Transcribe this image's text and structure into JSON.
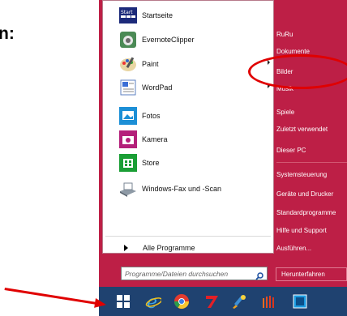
{
  "cut_label": "n:",
  "start_menu": {
    "programs": [
      {
        "label": "Startseite",
        "icon": "startseite-icon",
        "has_submenu": false
      },
      {
        "label": "EvernoteClipper",
        "icon": "evernote-icon",
        "has_submenu": false
      },
      {
        "label": "Paint",
        "icon": "paint-icon",
        "has_submenu": true
      },
      {
        "label": "WordPad",
        "icon": "wordpad-icon",
        "has_submenu": true
      },
      {
        "label": "Fotos",
        "icon": "photos-icon",
        "has_submenu": false
      },
      {
        "label": "Kamera",
        "icon": "camera-icon",
        "has_submenu": false
      },
      {
        "label": "Store",
        "icon": "store-icon",
        "has_submenu": false
      },
      {
        "label": "Windows-Fax und -Scan",
        "icon": "fax-scan-icon",
        "has_submenu": false
      }
    ],
    "all_programs": "Alle Programme",
    "search_placeholder": "Programme/Dateien durchsuchen",
    "startseite_badge": "Start",
    "right_items": [
      "RuRu",
      "Dokumente",
      "Bilder",
      "Musik",
      "Spiele",
      "Zuletzt verwendet",
      "Dieser PC",
      "Systemsteuerung",
      "Geräte und Drucker",
      "Standardprogramme",
      "Hilfe und Support",
      "Ausführen..."
    ],
    "shutdown": "Herunterfahren"
  },
  "taskbar": {
    "buttons": [
      "windows-start-icon",
      "internet-explorer-icon",
      "chrome-icon",
      "seven-icon",
      "paint-brush-icon",
      "bars-icon",
      "app-icon"
    ]
  },
  "colors": {
    "menu_bg": "#bd1f46",
    "taskbar_bg": "#1f4270",
    "annotation": "#e00000"
  }
}
